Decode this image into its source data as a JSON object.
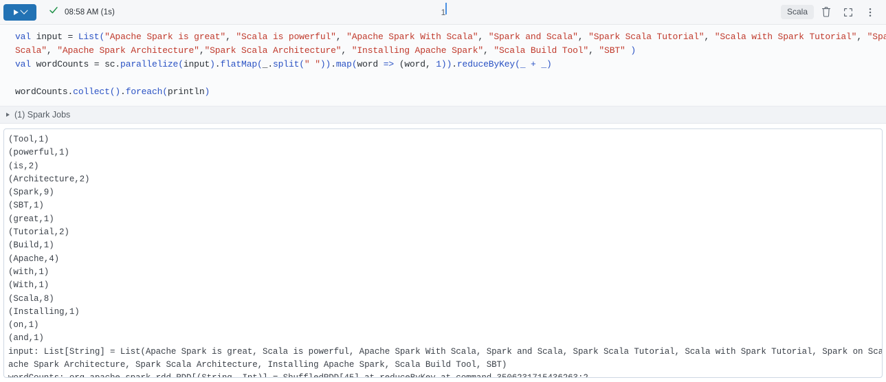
{
  "toolbar": {
    "run_button": {
      "name": "run-cell",
      "icon": "play-icon",
      "dropdown_icon": "chevron-down-icon",
      "color": "#2272b4"
    },
    "status_icon": "check-icon",
    "status_color": "#1f9147",
    "status_text": "08:58 AM (1s)",
    "cell_number": "1",
    "language_badge": "Scala",
    "icons": [
      {
        "name": "trash-icon",
        "label": "Delete"
      },
      {
        "name": "expand-icon",
        "label": "Fullscreen"
      },
      {
        "name": "more-vertical-icon",
        "label": "More"
      }
    ]
  },
  "code": {
    "lines": [
      {
        "id": "line-1",
        "tokens": [
          {
            "t": "kw",
            "v": "val"
          },
          {
            "t": "pl",
            "v": " input = "
          },
          {
            "t": "fn",
            "v": "List"
          },
          {
            "t": "op",
            "v": "("
          },
          {
            "t": "str",
            "v": "\"Apache Spark is great\""
          },
          {
            "t": "pl",
            "v": ", "
          },
          {
            "t": "str",
            "v": "\"Scala is powerful\""
          },
          {
            "t": "pl",
            "v": ", "
          },
          {
            "t": "str",
            "v": "\"Apache Spark With Scala\""
          },
          {
            "t": "pl",
            "v": ", "
          },
          {
            "t": "str",
            "v": "\"Spark and Scala\""
          },
          {
            "t": "pl",
            "v": ", "
          },
          {
            "t": "str",
            "v": "\"Spark Scala Tutorial\""
          },
          {
            "t": "pl",
            "v": ", "
          },
          {
            "t": "str",
            "v": "\"Scala with Spark Tutorial\""
          },
          {
            "t": "pl",
            "v": ", "
          },
          {
            "t": "str",
            "v": "\"Spark on"
          }
        ]
      },
      {
        "id": "line-1-cont",
        "tokens": [
          {
            "t": "str",
            "v": "Scala\""
          },
          {
            "t": "pl",
            "v": ", "
          },
          {
            "t": "str",
            "v": "\"Apache Spark Architecture\""
          },
          {
            "t": "pl",
            "v": ","
          },
          {
            "t": "str",
            "v": "\"Spark Scala Architecture\""
          },
          {
            "t": "pl",
            "v": ", "
          },
          {
            "t": "str",
            "v": "\"Installing Apache Spark\""
          },
          {
            "t": "pl",
            "v": ", "
          },
          {
            "t": "str",
            "v": "\"Scala Build Tool\""
          },
          {
            "t": "pl",
            "v": ", "
          },
          {
            "t": "str",
            "v": "\"SBT\""
          },
          {
            "t": "pl",
            "v": " "
          },
          {
            "t": "op",
            "v": ")"
          }
        ]
      },
      {
        "id": "line-2",
        "tokens": [
          {
            "t": "kw",
            "v": "val"
          },
          {
            "t": "pl",
            "v": " wordCounts = sc."
          },
          {
            "t": "mth",
            "v": "parallelize"
          },
          {
            "t": "op",
            "v": "("
          },
          {
            "t": "pl",
            "v": "input"
          },
          {
            "t": "op",
            "v": ")"
          },
          {
            "t": "pl",
            "v": "."
          },
          {
            "t": "mth",
            "v": "flatMap"
          },
          {
            "t": "op",
            "v": "("
          },
          {
            "t": "pl",
            "v": "_."
          },
          {
            "t": "mth",
            "v": "split"
          },
          {
            "t": "op",
            "v": "("
          },
          {
            "t": "str",
            "v": "\" \""
          },
          {
            "t": "op",
            "v": "))"
          },
          {
            "t": "pl",
            "v": "."
          },
          {
            "t": "mth",
            "v": "map"
          },
          {
            "t": "op",
            "v": "("
          },
          {
            "t": "pl",
            "v": "word "
          },
          {
            "t": "kw",
            "v": "=>"
          },
          {
            "t": "pl",
            "v": " (word, "
          },
          {
            "t": "num",
            "v": "1"
          },
          {
            "t": "op",
            "v": "))"
          },
          {
            "t": "pl",
            "v": "."
          },
          {
            "t": "mth",
            "v": "reduceByKey"
          },
          {
            "t": "op",
            "v": "(_ + _)"
          }
        ]
      }
    ],
    "blank_line": true,
    "last_line": {
      "id": "line-3",
      "tokens": [
        {
          "t": "pl",
          "v": "wordCounts."
        },
        {
          "t": "mth",
          "v": "collect"
        },
        {
          "t": "op",
          "v": "()"
        },
        {
          "t": "pl",
          "v": "."
        },
        {
          "t": "mth",
          "v": "foreach"
        },
        {
          "t": "op",
          "v": "("
        },
        {
          "t": "pl",
          "v": "println"
        },
        {
          "t": "op",
          "v": ")"
        }
      ]
    }
  },
  "spark_jobs": {
    "expand_icon": "triangle-right-icon",
    "label": "(1) Spark Jobs"
  },
  "output": {
    "lines": [
      "(Tool,1)",
      "(powerful,1)",
      "(is,2)",
      "(Architecture,2)",
      "(Spark,9)",
      "(SBT,1)",
      "(great,1)",
      "(Tutorial,2)",
      "(Build,1)",
      "(Apache,4)",
      "(with,1)",
      "(With,1)",
      "(Scala,8)",
      "(Installing,1)",
      "(on,1)",
      "(and,1)",
      "input: List[String] = List(Apache Spark is great, Scala is powerful, Apache Spark With Scala, Spark and Scala, Spark Scala Tutorial, Scala with Spark Tutorial, Spark on Scala, Ap",
      "ache Spark Architecture, Spark Scala Architecture, Installing Apache Spark, Scala Build Tool, SBT)",
      "wordCounts: org.apache.spark.rdd.RDD[(String, Int)] = ShuffledRDD[45] at reduceByKey at command-3506231715436263:2"
    ]
  }
}
